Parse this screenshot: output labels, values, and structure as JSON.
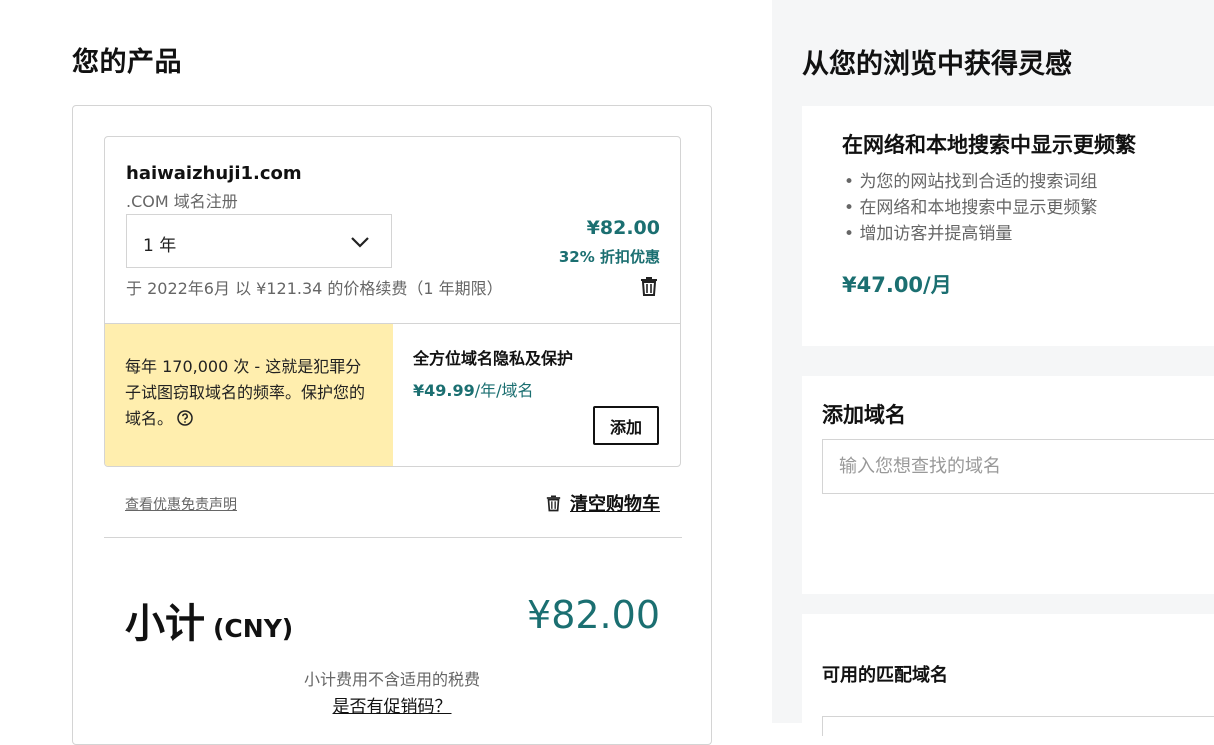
{
  "cart": {
    "title": "您的产品",
    "item": {
      "domain": "haiwaizhuji1.com",
      "type": ".COM 域名注册",
      "term": "1 年",
      "price": "¥82.00",
      "discount": "32% 折扣优惠",
      "renewal": "于 2022年6月 以 ¥121.34 的价格续费（1 年期限）"
    },
    "privacy_upsell": {
      "note": "每年 170,000 次 - 这就是犯罪分子试图窃取域名的频率。保护您的域名。",
      "title": "全方位域名隐私及保护",
      "price_amount": "¥49.99",
      "price_unit": "/年/域名",
      "add_label": "添加"
    },
    "disclaimer_link": "查看优惠免责声明",
    "clear_cart_label": "清空购物车",
    "subtotal_label": "小计",
    "subtotal_currency": "(CNY)",
    "subtotal_value": "¥82.00",
    "tax_note": "小计费用不含适用的税费",
    "promo_link": "是否有促销码？"
  },
  "inspiration": {
    "title": "从您的浏览中获得灵感",
    "seo_card": {
      "title": "在网络和本地搜索中显示更频繁",
      "bullets": [
        "为您的网站找到合适的搜索词组",
        "在网络和本地搜索中显示更频繁",
        "增加访客并提高销量"
      ],
      "price": "¥47.00/月"
    },
    "add_domain": {
      "title": "添加域名",
      "placeholder": "输入您想查找的域名"
    },
    "matches": {
      "title": "可用的匹配域名"
    }
  },
  "colors": {
    "accent": "#1b6f71",
    "upsell_bg": "#ffeeae",
    "right_panel_bg": "#f5f6f7"
  }
}
